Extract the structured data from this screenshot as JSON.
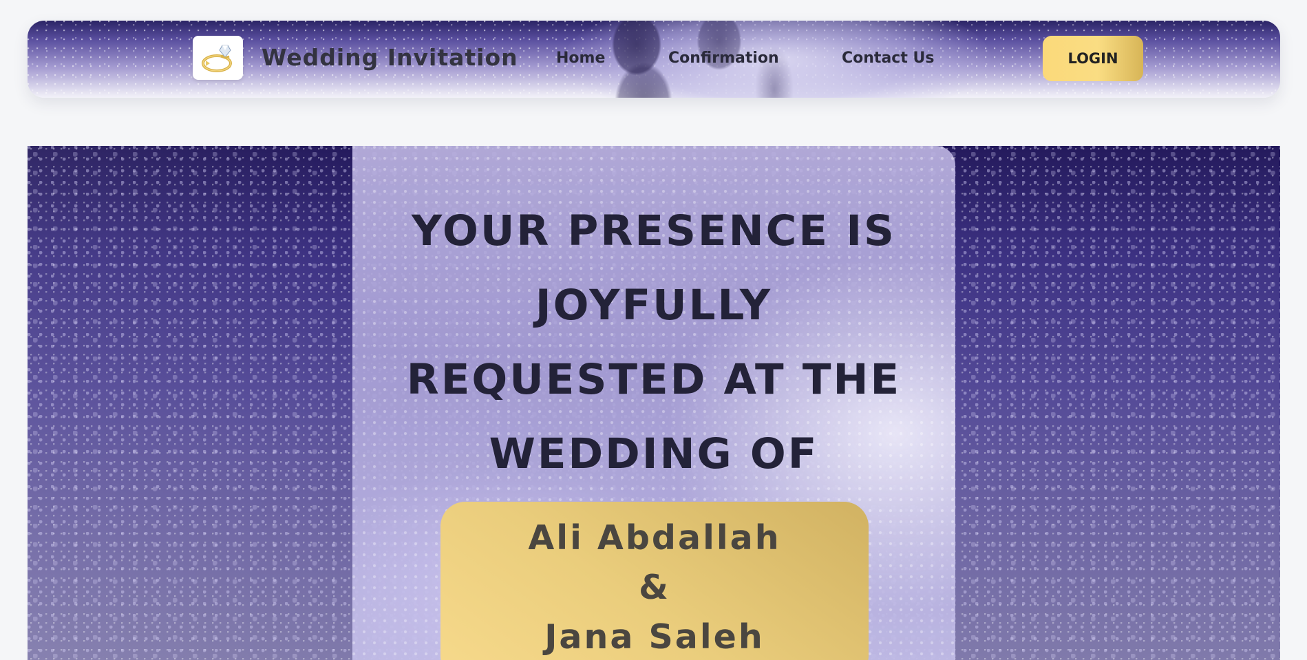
{
  "header": {
    "brand": "Wedding Invitation",
    "logo_icon": "ring-icon",
    "nav": [
      "Home",
      "Confirmation",
      "Contact Us"
    ],
    "login_label": "LOGIN"
  },
  "hero": {
    "headline_lines": [
      "YOUR PRESENCE IS",
      "JOYFULLY",
      "REQUESTED AT THE",
      "WEDDING OF"
    ],
    "groom": "Ali Abdallah",
    "ampersand": "&",
    "bride": "Jana Saleh"
  },
  "colors": {
    "gold": "#f7da8c",
    "purple_dark": "#241a5c",
    "purple_mid": "#544a97",
    "text_dark": "#232238"
  }
}
